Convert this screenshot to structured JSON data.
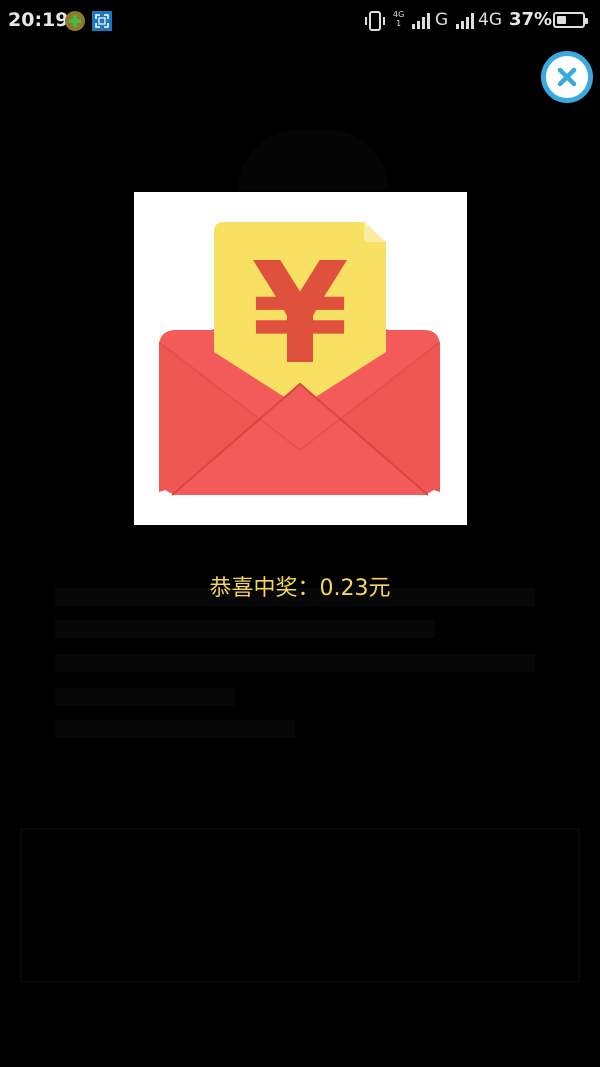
{
  "status_bar": {
    "time": "20:19",
    "lte_top": "4G",
    "lte_bottom": "1",
    "network_1": "G",
    "network_2": "4G",
    "battery_percent": "37%",
    "battery_level": 0.37
  },
  "dialog": {
    "prize_message": "恭喜中奖：0.23元",
    "envelope_symbol": "¥"
  },
  "colors": {
    "prize_text": "#f6d65a",
    "close_ring": "#3aa9dd",
    "envelope_red": "#f25b59",
    "card_yellow": "#f7e062",
    "yen_red": "#e0513d"
  }
}
